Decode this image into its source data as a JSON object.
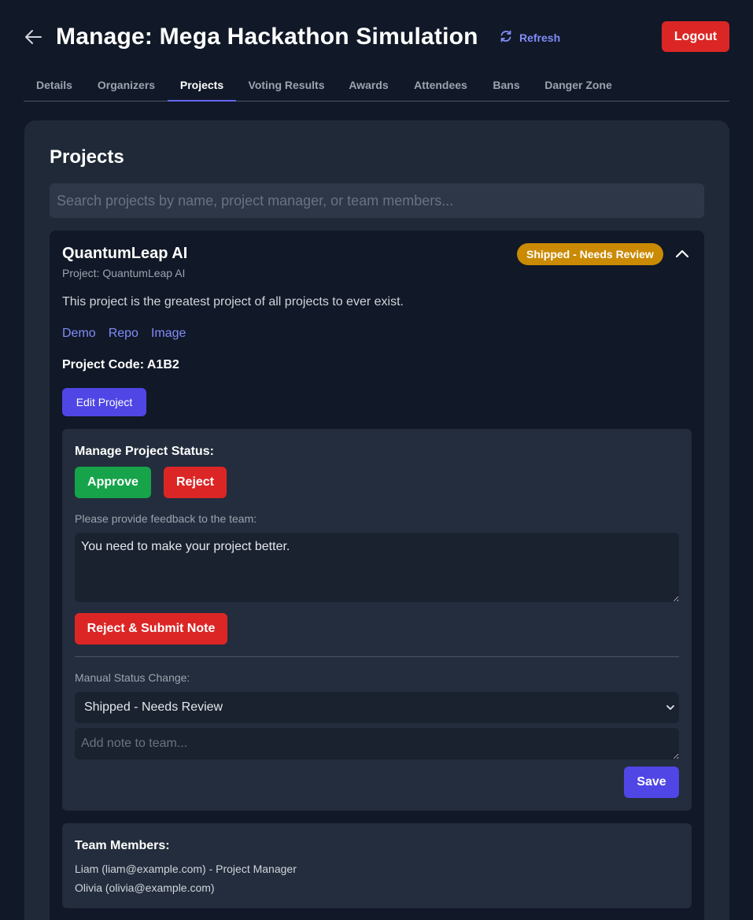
{
  "header": {
    "title": "Manage: Mega Hackathon Simulation",
    "refresh_label": "Refresh",
    "logout_label": "Logout"
  },
  "tabs": [
    {
      "label": "Details",
      "active": false
    },
    {
      "label": "Organizers",
      "active": false
    },
    {
      "label": "Projects",
      "active": true
    },
    {
      "label": "Voting Results",
      "active": false
    },
    {
      "label": "Awards",
      "active": false
    },
    {
      "label": "Attendees",
      "active": false
    },
    {
      "label": "Bans",
      "active": false
    },
    {
      "label": "Danger Zone",
      "active": false
    }
  ],
  "projects": {
    "section_title": "Projects",
    "search_placeholder": "Search projects by name, project manager, or team members...",
    "project": {
      "name": "QuantumLeap AI",
      "subtitle": "Project: QuantumLeap AI",
      "status_badge": "Shipped - Needs Review",
      "description": "This project is the greatest project of all projects to ever exist.",
      "links": [
        "Demo",
        "Repo",
        "Image"
      ],
      "code_line": "Project Code: A1B2",
      "edit_label": "Edit Project",
      "status_panel": {
        "heading": "Manage Project Status:",
        "approve_label": "Approve",
        "reject_label": "Reject",
        "feedback_label": "Please provide feedback to the team:",
        "feedback_value": "You need to make your project better.",
        "reject_submit_label": "Reject & Submit Note",
        "manual_label": "Manual Status Change:",
        "selected_status": "Shipped - Needs Review",
        "note_placeholder": "Add note to team...",
        "save_label": "Save"
      },
      "team": {
        "heading": "Team Members:",
        "members": [
          "Liam (liam@example.com) - Project Manager",
          "Olivia (olivia@example.com)"
        ]
      }
    }
  }
}
